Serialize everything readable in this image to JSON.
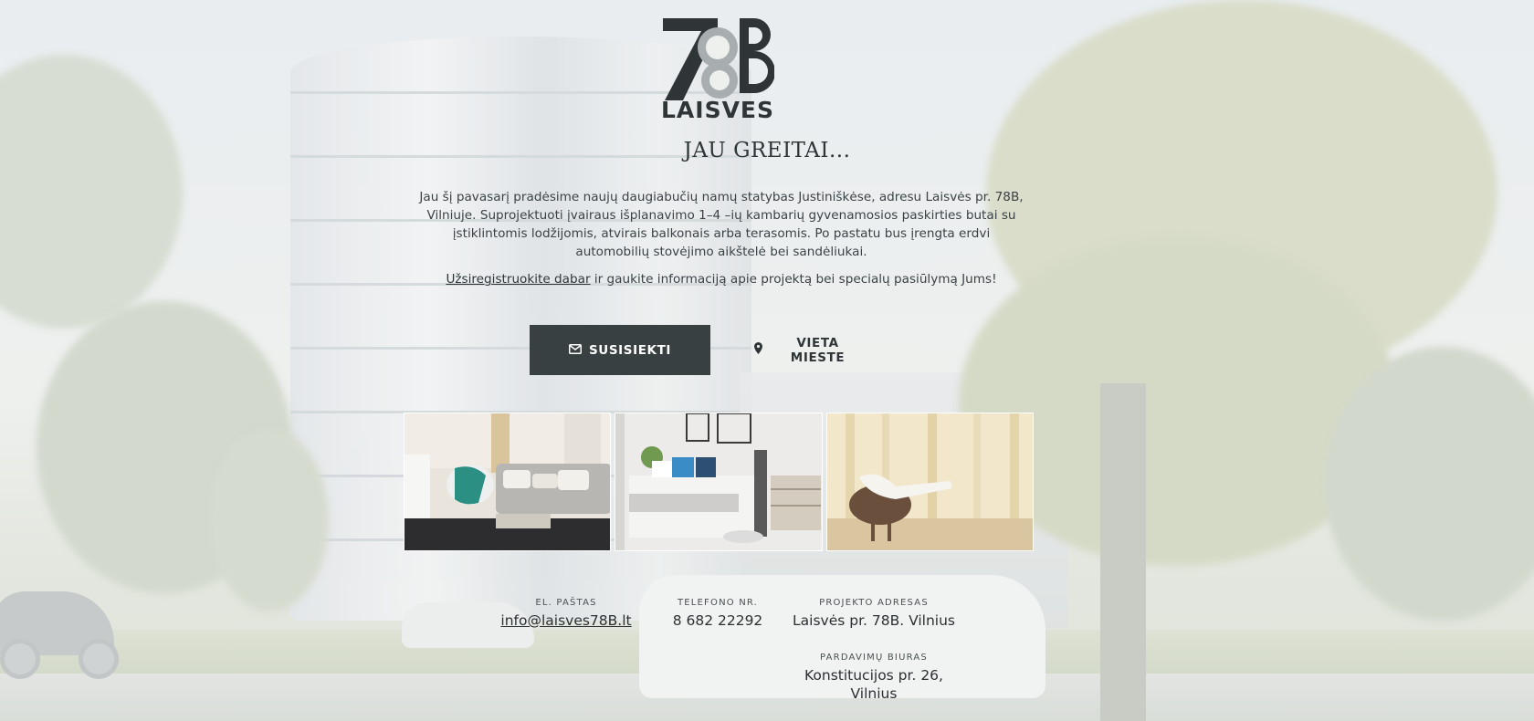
{
  "brand": {
    "logo_number": "78B",
    "logo_word": "LAISVES"
  },
  "title": "JAU GREITAI...",
  "description": "Jau šį pavasarį pradėsime naujų daugiabučių namų statybas Justiniškėse, adresu Laisvės pr. 78B, Vilniuje. Suprojektuoti įvairaus išplanavimo 1–4 –ių kambarių gyvenamosios paskirties butai su įstiklintomis lodžijomis, atvirais balkonais arba terasomis. Po pastatu bus įrengta erdvi automobilių stovėjimo aikštelė bei sandėliukai.",
  "cta": {
    "link_text": "Užsiregistruokite dabar",
    "rest_text": " ir gaukite informaciją apie projektą bei specialų pasiūlymą Jums!"
  },
  "buttons": {
    "contact_label": "SUSISIEKTI",
    "contact_icon": "envelope-icon",
    "location_label": "VIETA MIESTE",
    "location_icon": "map-pin-icon"
  },
  "gallery": [
    {
      "icon": "living-room-photo"
    },
    {
      "icon": "bedroom-photo"
    },
    {
      "icon": "relaxing-woman-photo"
    }
  ],
  "contacts": {
    "email_label": "EL. PAŠTAS",
    "email_value": "info@laisves78B.lt",
    "phone_label": "TELEFONO NR.",
    "phone_value": "8 682 22292",
    "address_label": "PROJEKTO ADRESAS",
    "address_value": "Laisvės pr. 78B. Vilnius",
    "office_label": "PARDAVIMŲ BIURAS",
    "office_value_line1": "Konstitucijos pr. 26,",
    "office_value_line2": "Vilnius"
  },
  "colors": {
    "button_dark": "#384042",
    "text_dark": "#2f3537"
  }
}
